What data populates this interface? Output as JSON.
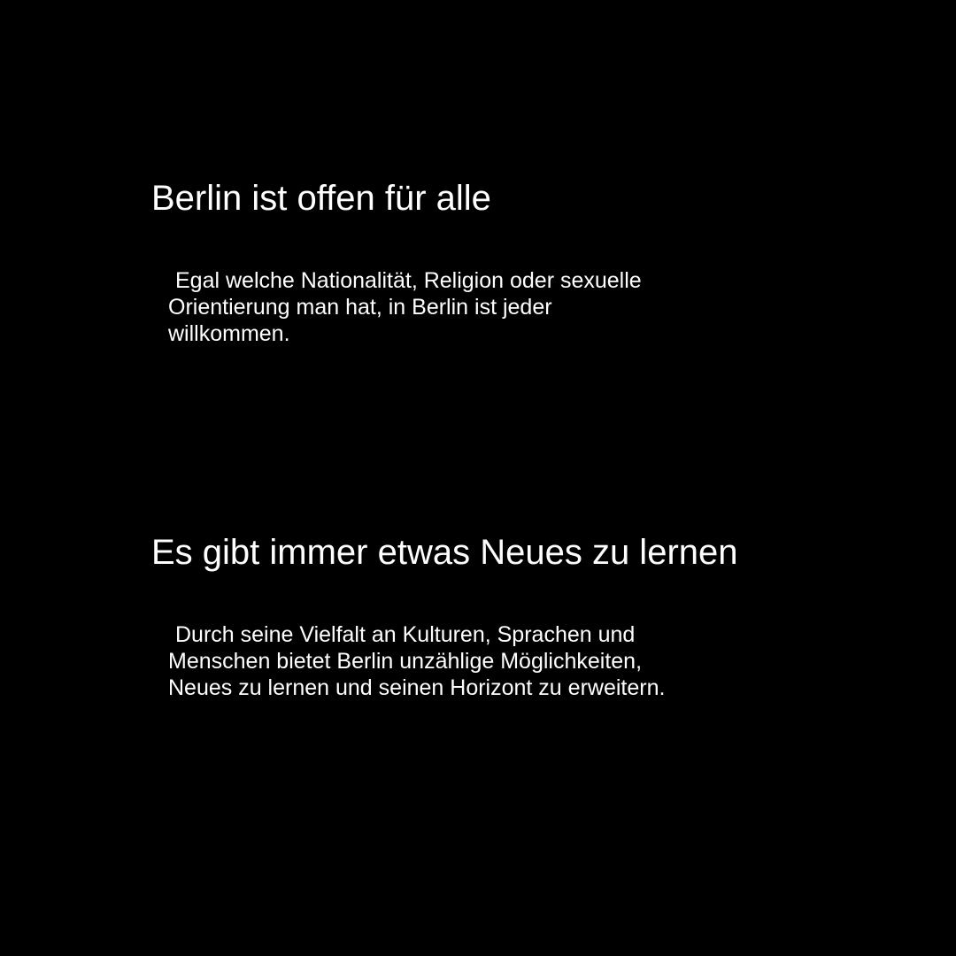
{
  "sections": [
    {
      "heading": "Berlin ist offen für alle",
      "body_lines": [
        "Egal welche Nationalität, Religion oder sexuelle",
        "Orientierung man hat, in Berlin ist jeder",
        "willkommen."
      ]
    },
    {
      "heading": "Es gibt immer etwas Neues zu lernen",
      "body_lines": [
        "Durch seine Vielfalt an Kulturen, Sprachen und",
        "Menschen bietet Berlin unzählige Möglichkeiten,",
        "Neues zu lernen und seinen Horizont zu erweitern."
      ]
    }
  ],
  "colors": {
    "background": "#000000",
    "text": "#ffffff"
  }
}
